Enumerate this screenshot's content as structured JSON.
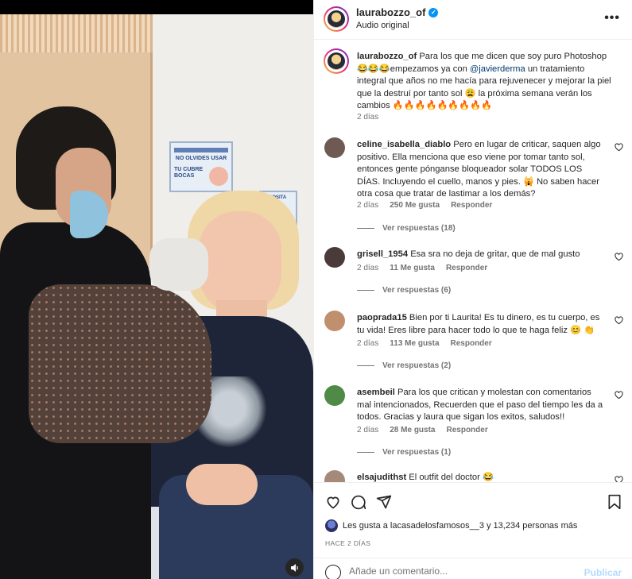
{
  "post": {
    "username": "laurabozzo_of",
    "audio": "Audio original",
    "more_icon": "more-dots-icon"
  },
  "caption": {
    "username": "laurabozzo_of",
    "text_before": "Para los que me dicen que soy puro Photoshop 😂😂😂empezamos ya con ",
    "mention": "@javierderma",
    "text_after": " un tratamiento integral que años no me hacía para rejuvenecer y mejorar la piel que la destruí por tanto sol 😩 la próxima semana verán los cambios 🔥🔥🔥🔥🔥🔥🔥🔥🔥",
    "time": "2 días"
  },
  "comments": [
    {
      "username": "celine_isabella_diablo",
      "text": "Pero en lugar de criticar, saquen algo positivo. Ella menciona que eso viene por tomar tanto sol, entonces gente pónganse bloqueador solar TODOS LOS DÍAS. Incluyendo el cuello, manos y pies. 🙀 No saben hacer otra cosa que tratar de lastimar a los demás?",
      "time": "2 días",
      "likes": "250 Me gusta",
      "reply": "Responder",
      "replies": "Ver respuestas (18)",
      "avatar_color": "#6e5a52"
    },
    {
      "username": "grisell_1954",
      "text": "Esa sra no deja de gritar, que de mal gusto",
      "time": "2 días",
      "likes": "11 Me gusta",
      "reply": "Responder",
      "replies": "Ver respuestas (6)",
      "avatar_color": "#4a3b3a"
    },
    {
      "username": "paoprada15",
      "text": "Bien por ti Laurita! Es tu dinero, es tu cuerpo, es tu vida! Eres libre para hacer todo lo que te haga feliz 😊 👏",
      "time": "2 días",
      "likes": "113 Me gusta",
      "reply": "Responder",
      "replies": "Ver respuestas (2)",
      "avatar_color": "#c08f6e"
    },
    {
      "username": "asembeil",
      "text": "Para los que critican y molestan con comentarios mal intencionados, Recuerden que el paso del tiempo les da a todos. Gracias y laura que sigan los exitos, saludos!!",
      "time": "2 días",
      "likes": "28 Me gusta",
      "reply": "Responder",
      "replies": "Ver respuestas (1)",
      "avatar_color": "#4f8a47"
    },
    {
      "username": "elsajudithst",
      "text": "El outfit del doctor 😂",
      "avatar_color": "#a58a7a"
    }
  ],
  "likes_line": "Les gusta a lacasadelosfamosos__3 y 13,234 personas más",
  "posted_ago": "HACE 2 DÍAS",
  "comment_box": {
    "placeholder": "Añade un comentario...",
    "publish": "Publicar"
  },
  "video": {
    "poster_title": "NO OLVIDES USAR",
    "poster_text": "TU CUBRE BOCAS",
    "poster2_text": "DEPOSITA"
  },
  "colors": {
    "accent": "#0095f6",
    "publish_disabled": "#b3dbff",
    "muted": "#737373"
  }
}
